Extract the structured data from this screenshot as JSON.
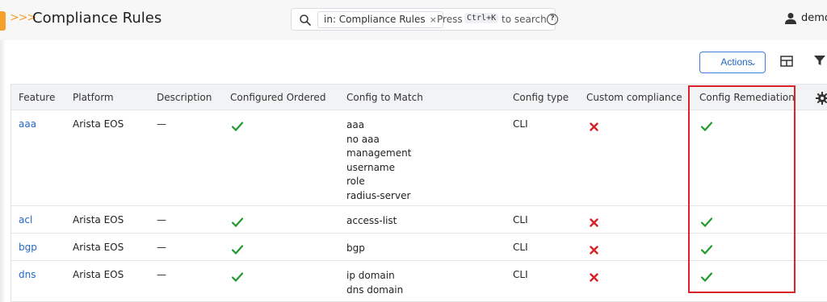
{
  "header": {
    "breadcrumb_chevrons": ">>>",
    "title": "Compliance Rules",
    "search": {
      "chip": "in: Compliance Rules",
      "chip_close": "×",
      "press": "Press",
      "shortcut": "Ctrl+K",
      "hint": "to search",
      "help": "?"
    },
    "user": "demo"
  },
  "toolbar": {
    "actions_label": "Actions",
    "actions_chevron": "⌄"
  },
  "table": {
    "columns": [
      "Feature",
      "Platform",
      "Description",
      "Configured Ordered",
      "Config to Match",
      "Config type",
      "Custom compliance",
      "Config Remediation"
    ],
    "rows": [
      {
        "feature": "aaa",
        "platform": "Arista EOS",
        "description": "—",
        "configured_ordered": true,
        "config_to_match": [
          "aaa",
          "no aaa",
          "management",
          "username",
          "role",
          "radius-server"
        ],
        "config_type": "CLI",
        "custom_compliance": false,
        "config_remediation": true
      },
      {
        "feature": "acl",
        "platform": "Arista EOS",
        "description": "—",
        "configured_ordered": true,
        "config_to_match": [
          "access-list"
        ],
        "config_type": "CLI",
        "custom_compliance": false,
        "config_remediation": true
      },
      {
        "feature": "bgp",
        "platform": "Arista EOS",
        "description": "—",
        "configured_ordered": true,
        "config_to_match": [
          "bgp"
        ],
        "config_type": "CLI",
        "custom_compliance": false,
        "config_remediation": true
      },
      {
        "feature": "dns",
        "platform": "Arista EOS",
        "description": "—",
        "configured_ordered": true,
        "config_to_match": [
          "ip domain",
          "dns domain"
        ],
        "config_type": "CLI",
        "custom_compliance": false,
        "config_remediation": true
      }
    ]
  },
  "colors": {
    "accent": "#f4a02a",
    "link": "#2468c9",
    "check": "#1f9a2f",
    "cross": "#d81f26",
    "highlight": "#d9222a"
  }
}
